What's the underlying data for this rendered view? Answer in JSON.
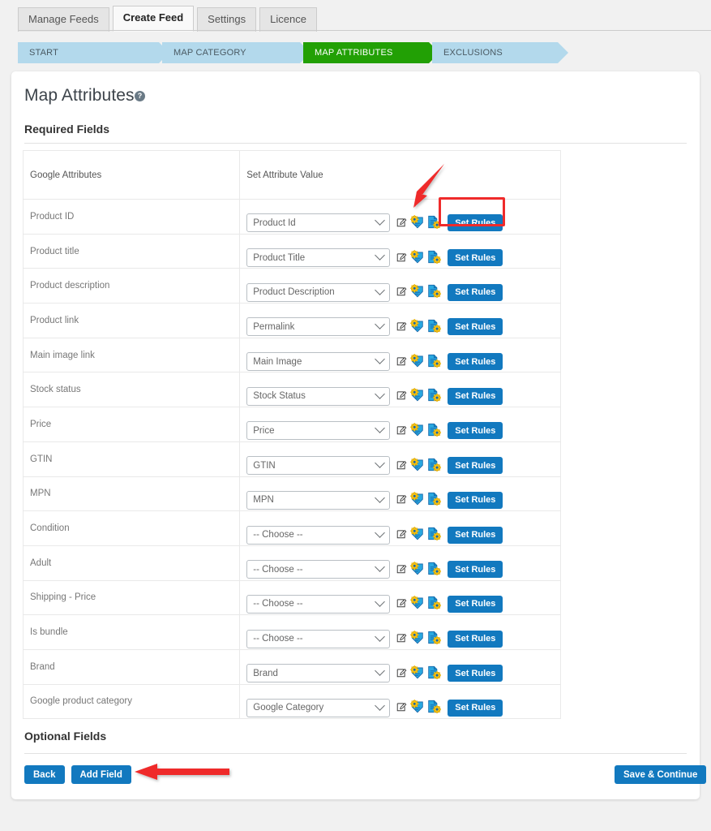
{
  "tabs": [
    {
      "label": "Manage Feeds",
      "active": false
    },
    {
      "label": "Create Feed",
      "active": true
    },
    {
      "label": "Settings",
      "active": false
    },
    {
      "label": "Licence",
      "active": false
    }
  ],
  "stepper": {
    "steps": [
      {
        "label": "START",
        "state": "done"
      },
      {
        "label": "MAP CATEGORY",
        "state": "done"
      },
      {
        "label": "MAP ATTRIBUTES",
        "state": "active"
      },
      {
        "label": "EXCLUSIONS",
        "state": "upcoming"
      }
    ],
    "active_color": "#22a005",
    "inactive_color": "#b3d9ec"
  },
  "page": {
    "title": "Map Attributes",
    "help_icon": "help-circle-icon",
    "help_glyph": "?",
    "required_section": "Required Fields",
    "optional_section": "Optional Fields"
  },
  "table": {
    "headers": [
      "Google Attributes",
      "Set Attribute Value"
    ],
    "row_icons": [
      "edit-square-icon",
      "tag-gear-icon",
      "document-gear-icon"
    ],
    "set_rules_label": "Set Rules",
    "rows": [
      {
        "attribute": "Product ID",
        "value": "Product Id"
      },
      {
        "attribute": "Product title",
        "value": "Product Title"
      },
      {
        "attribute": "Product description",
        "value": "Product Description"
      },
      {
        "attribute": "Product link",
        "value": "Permalink"
      },
      {
        "attribute": "Main image link",
        "value": "Main Image"
      },
      {
        "attribute": "Stock status",
        "value": "Stock Status"
      },
      {
        "attribute": "Price",
        "value": "Price"
      },
      {
        "attribute": "GTIN",
        "value": "GTIN"
      },
      {
        "attribute": "MPN",
        "value": "MPN"
      },
      {
        "attribute": "Condition",
        "value": "-- Choose --"
      },
      {
        "attribute": "Adult",
        "value": "-- Choose --"
      },
      {
        "attribute": "Shipping - Price",
        "value": "-- Choose --"
      },
      {
        "attribute": "Is bundle",
        "value": "-- Choose --"
      },
      {
        "attribute": "Brand",
        "value": "Brand"
      },
      {
        "attribute": "Google product category",
        "value": "Google Category"
      }
    ]
  },
  "footer": {
    "back_label": "Back",
    "add_field_label": "Add Field",
    "save_continue_label": "Save & Continue"
  },
  "annotations": {
    "color": "#ef2b2b",
    "arrow_to_icons": "arrow-pointing-to-rule-icons",
    "arrow_to_add_field": "arrow-pointing-to-add-field",
    "highlight_box": "set-rules-highlight-box"
  },
  "theme": {
    "button_blue": "#1279bf",
    "annotation_red": "#ef2b2b"
  }
}
